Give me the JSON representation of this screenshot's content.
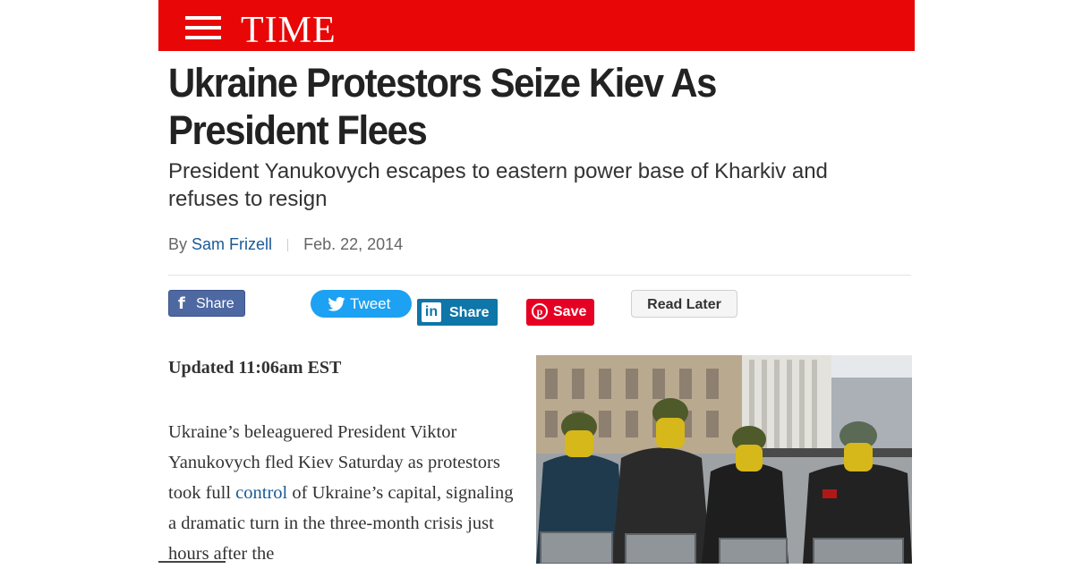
{
  "header": {
    "logo": "TIME",
    "menu_icon": "hamburger-menu-icon",
    "brand_color": "#e90606"
  },
  "article": {
    "headline": "Ukraine Protestors Seize Kiev As President Flees",
    "subheadline": "President Yanukovych escapes to eastern power base of Kharkiv and refuses to resign",
    "byline_prefix": "By",
    "author": "Sam Frizell",
    "date": "Feb. 22, 2014",
    "updated": "Updated 11:06am EST",
    "body_before_link": "Ukraine’s beleaguered President Viktor Yanukovych fled Kiev Saturday as protestors took full ",
    "body_link": "control",
    "body_after_link": " of Ukraine’s capital, signaling a dramatic turn in the three-month crisis just hours after the"
  },
  "share": {
    "facebook_label": "Share",
    "twitter_label": "Tweet",
    "linkedin_label": "Share",
    "pinterest_label": "Save",
    "read_later_label": "Read Later"
  },
  "colors": {
    "link": "#1a5a96",
    "facebook": "#4e69a2",
    "twitter": "#1da1f2",
    "linkedin": "#0e76a8",
    "pinterest": "#e60023"
  }
}
